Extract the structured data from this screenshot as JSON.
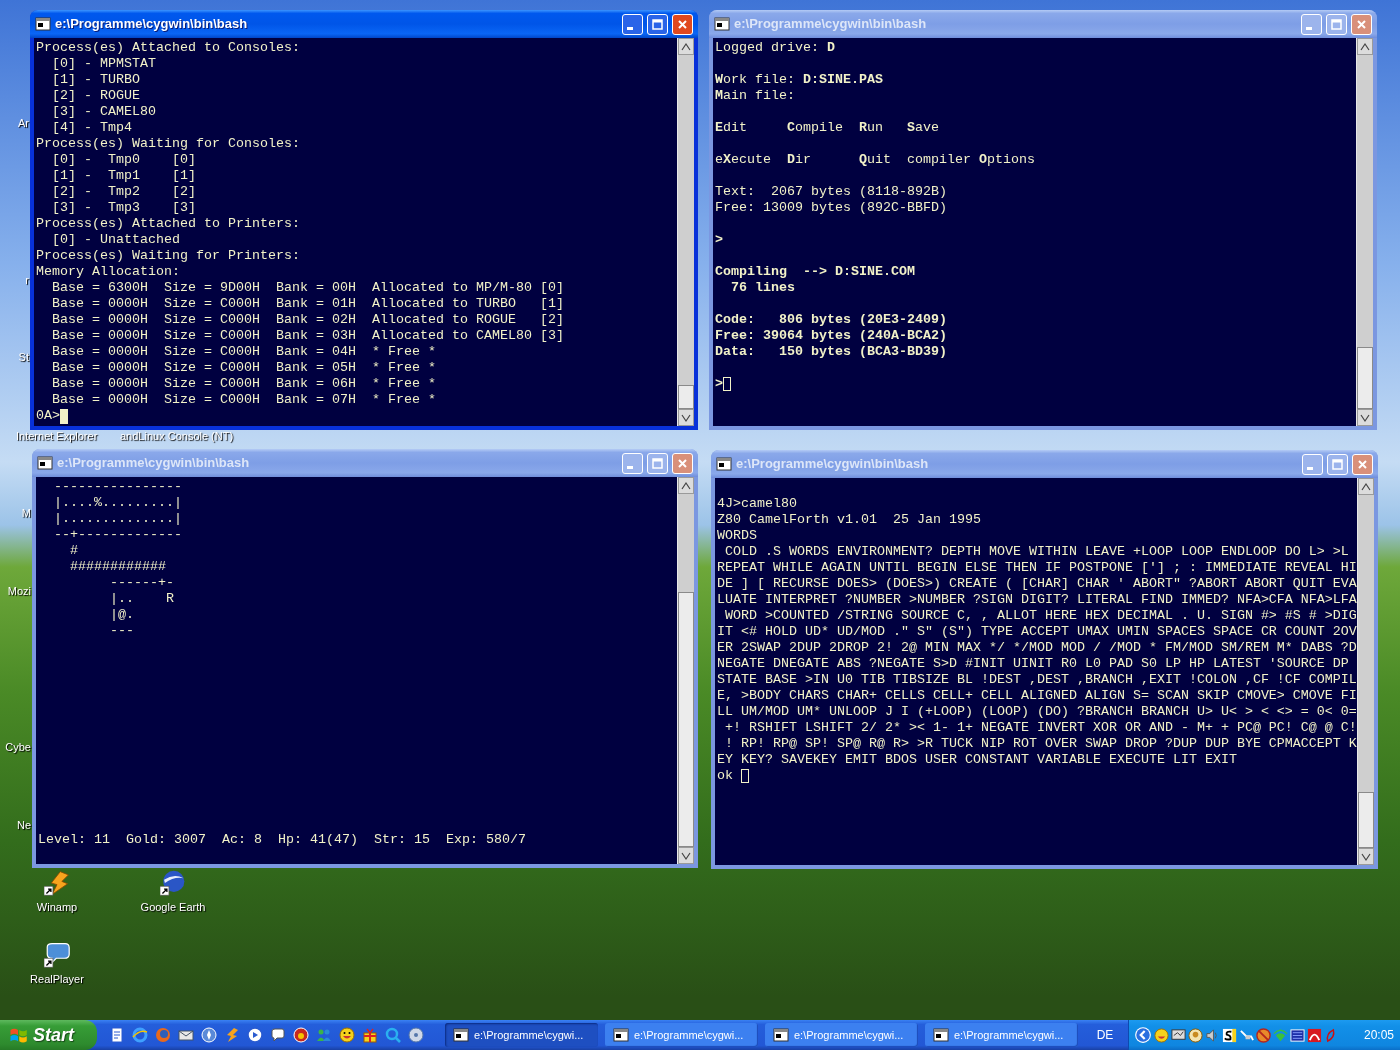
{
  "desktop": {
    "icons": [
      {
        "label": "Ar",
        "kind": "partial"
      },
      {
        "label": "r",
        "kind": "partial"
      },
      {
        "label": "St",
        "kind": "partial"
      },
      {
        "label": "Internet Explorer",
        "kind": "label"
      },
      {
        "label": "andLinux Console (NT)",
        "kind": "label"
      },
      {
        "label": "M",
        "kind": "partial"
      },
      {
        "label": "Mozi",
        "kind": "partial"
      },
      {
        "label": "Cybe",
        "kind": "partial"
      },
      {
        "label": "Ne",
        "kind": "partial"
      },
      {
        "label": "Winamp",
        "kind": "shortcut"
      },
      {
        "label": "Google Earth",
        "kind": "shortcut"
      },
      {
        "label": "RealPlayer",
        "kind": "shortcut"
      }
    ]
  },
  "windows": [
    {
      "title": "e:\\Programme\\cygwin\\bin\\bash",
      "active": true,
      "cursor": {
        "kind": "block"
      },
      "blocks": [
        {
          "kind": "plain",
          "lines": [
            "Process(es) Attached to Consoles:",
            "  [0] - MPMSTAT",
            "  [1] - TURBO",
            "  [2] - ROGUE",
            "  [3] - CAMEL80",
            "  [4] - Tmp4",
            "Process(es) Waiting for Consoles:",
            "  [0] -  Tmp0    [0]",
            "  [1] -  Tmp1    [1]",
            "  [2] -  Tmp2    [2]",
            "  [3] -  Tmp3    [3]",
            "Process(es) Attached to Printers:",
            "  [0] - Unattached",
            "Process(es) Waiting for Printers:",
            "Memory Allocation:",
            "  Base = 6300H  Size = 9D00H  Bank = 00H  Allocated to MP/M-80 [0]",
            "  Base = 0000H  Size = C000H  Bank = 01H  Allocated to TURBO   [1]",
            "  Base = 0000H  Size = C000H  Bank = 02H  Allocated to ROGUE   [2]",
            "  Base = 0000H  Size = C000H  Bank = 03H  Allocated to CAMEL80 [3]",
            "  Base = 0000H  Size = C000H  Bank = 04H  * Free *",
            "  Base = 0000H  Size = C000H  Bank = 05H  * Free *",
            "  Base = 0000H  Size = C000H  Bank = 06H  * Free *",
            "  Base = 0000H  Size = C000H  Bank = 07H  * Free *",
            "0A>"
          ]
        }
      ]
    },
    {
      "title": "e:\\Programme\\cygwin\\bin\\bash",
      "active": false,
      "cursor": {
        "kind": "hollow"
      },
      "blocks": [
        {
          "kind": "highlighted",
          "lines": [
            "Logged drive: **D**"
          ]
        },
        {
          "kind": "highlighted",
          "lines": [
            "**W**ork file: **D:SINE.PAS**",
            "**M**ain file:"
          ]
        },
        {
          "kind": "highlighted",
          "lines": [
            "**E**dit     **C**ompile  **R**un   **S**ave"
          ]
        },
        {
          "kind": "highlighted",
          "lines": [
            "e**X**ecute  **D**ir      **Q**uit  compiler **O**ptions"
          ]
        },
        {
          "kind": "plain",
          "lines": [
            "Text:  2067 bytes (8118-892B)",
            "Free: 13009 bytes (892C-BBFD)"
          ]
        },
        {
          "kind": "bold",
          "lines": [
            ">"
          ]
        },
        {
          "kind": "bold",
          "lines": [
            "Compiling  --> D:SINE.COM",
            "  76 lines"
          ]
        },
        {
          "kind": "bold",
          "lines": [
            "Code:   806 bytes (20E3-2409)",
            "Free: 39064 bytes (240A-BCA2)",
            "Data:   150 bytes (BCA3-BD39)"
          ]
        },
        {
          "kind": "bold",
          "lines": [
            ">"
          ]
        }
      ]
    },
    {
      "title": "e:\\Programme\\cygwin\\bin\\bash",
      "active": false,
      "blocks": [
        {
          "kind": "plain",
          "lines": [
            "  ----------------",
            "  |....%.........|",
            "  |..............|",
            "  --+-------------",
            "    #",
            "    ############",
            "         ------+-",
            "         |..    R",
            "         |@.",
            "         ---"
          ]
        }
      ],
      "status_line": "Level: 11  Gold: 3007  Ac: 8  Hp: 41(47)  Str: 15  Exp: 580/7"
    },
    {
      "title": "e:\\Programme\\cygwin\\bin\\bash",
      "active": false,
      "cursor": {
        "kind": "hollow"
      },
      "blocks": [
        {
          "kind": "plain",
          "lines": [
            "4J>camel80",
            "Z80 CamelForth v1.01  25 Jan 1995",
            "WORDS",
            " COLD .S WORDS ENVIRONMENT? DEPTH MOVE WITHIN LEAVE +LOOP LOOP ENDLOOP DO L> >L",
            "REPEAT WHILE AGAIN UNTIL BEGIN ELSE THEN IF POSTPONE ['] ; : IMMEDIATE REVEAL HI",
            "DE ] [ RECURSE DOES> (DOES>) CREATE ( [CHAR] CHAR ' ABORT\" ?ABORT ABORT QUIT EVA",
            "LUATE INTERPRET ?NUMBER >NUMBER ?SIGN DIGIT? LITERAL FIND IMMED? NFA>CFA NFA>LFA",
            " WORD >COUNTED /STRING SOURCE C, , ALLOT HERE HEX DECIMAL . U. SIGN #> #S # >DIG",
            "IT <# HOLD UD* UD/MOD .\" S\" (S\") TYPE ACCEPT UMAX UMIN SPACES SPACE CR COUNT 2OV",
            "ER 2SWAP 2DUP 2DROP 2! 2@ MIN MAX */ */MOD MOD / /MOD * FM/MOD SM/REM M* DABS ?D",
            "NEGATE DNEGATE ABS ?NEGATE S>D #INIT UINIT R0 L0 PAD S0 LP HP LATEST 'SOURCE DP",
            "STATE BASE >IN U0 TIB TIBSIZE BL !DEST ,DEST ,BRANCH ,EXIT !COLON ,CF !CF COMPIL",
            "E, >BODY CHARS CHAR+ CELLS CELL+ CELL ALIGNED ALIGN S= SCAN SKIP CMOVE> CMOVE FI",
            "LL UM/MOD UM* UNLOOP J I (+LOOP) (LOOP) (DO) ?BRANCH BRANCH U> U< > < <> = 0< 0=",
            " +! RSHIFT LSHIFT 2/ 2* >< 1- 1+ NEGATE INVERT XOR OR AND - M+ + PC@ PC! C@ @ C!",
            " ! RP! RP@ SP! SP@ R@ R> >R TUCK NIP ROT OVER SWAP DROP ?DUP DUP BYE CPMACCEPT K",
            "EY KEY? SAVEKEY EMIT BDOS USER CONSTANT VARIABLE EXECUTE LIT EXIT",
            "ok "
          ]
        }
      ]
    }
  ],
  "taskbar": {
    "start_label": "Start",
    "tasks": [
      {
        "label": "e:\\Programme\\cygwi...",
        "selected": true
      },
      {
        "label": "e:\\Programme\\cygwi...",
        "selected": false
      },
      {
        "label": "e:\\Programme\\cygwi...",
        "selected": false
      },
      {
        "label": "e:\\Programme\\cygwi...",
        "selected": false
      }
    ],
    "language": "DE",
    "clock": "20:05"
  }
}
